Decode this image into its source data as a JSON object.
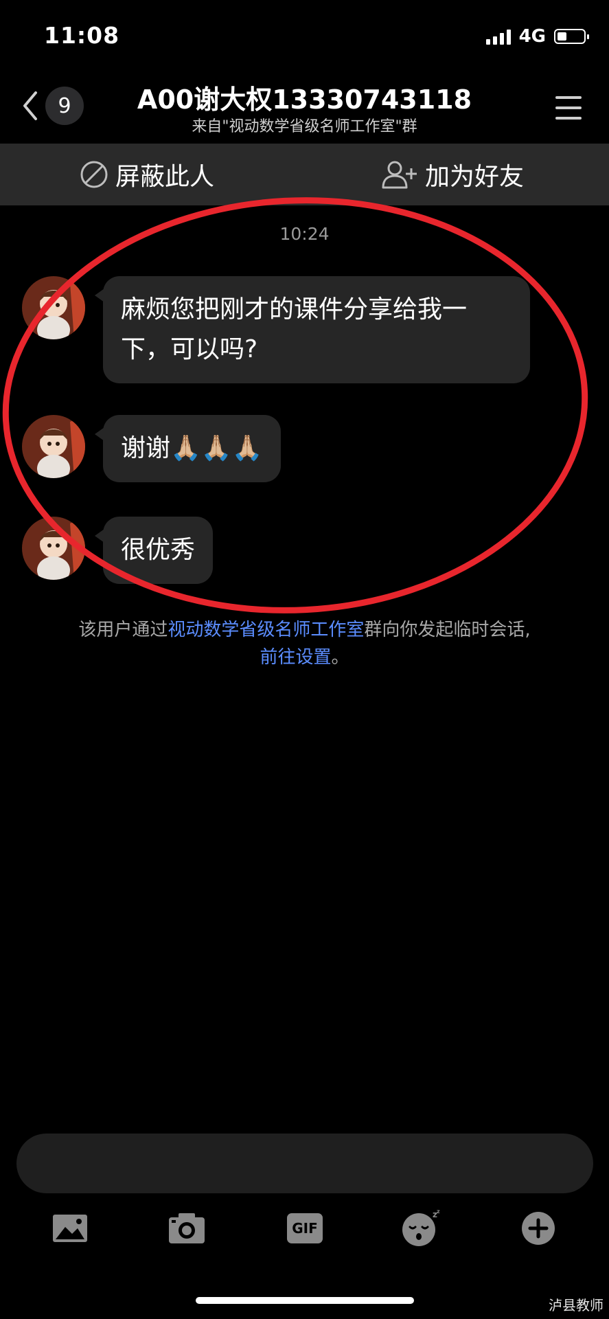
{
  "status_bar": {
    "time": "11:08",
    "network": "4G"
  },
  "header": {
    "back_badge": "9",
    "title": "A00谢大权13330743118",
    "subtitle": "来自\"视动数学省级名师工作室\"群"
  },
  "actions": {
    "block": "屏蔽此人",
    "add_friend": "加为好友"
  },
  "chat": {
    "timestamp": "10:24",
    "messages": [
      {
        "text": "麻烦您把刚才的课件分享给我一下，可以吗?"
      },
      {
        "text": "谢谢",
        "emoji": "🙏🏼🙏🏼🙏🏼"
      },
      {
        "text": "很优秀"
      }
    ]
  },
  "notice": {
    "prefix": "该用户通过",
    "group_link": "视动数学省级名师工作室",
    "suffix": "群向你发起临时会话,",
    "settings_link": "前往设置",
    "end": "。"
  },
  "input": {
    "placeholder": ""
  },
  "toolbar": {
    "gif_label": "GIF"
  },
  "annotation_color": "#e8262d",
  "watermark": "泸县教师"
}
